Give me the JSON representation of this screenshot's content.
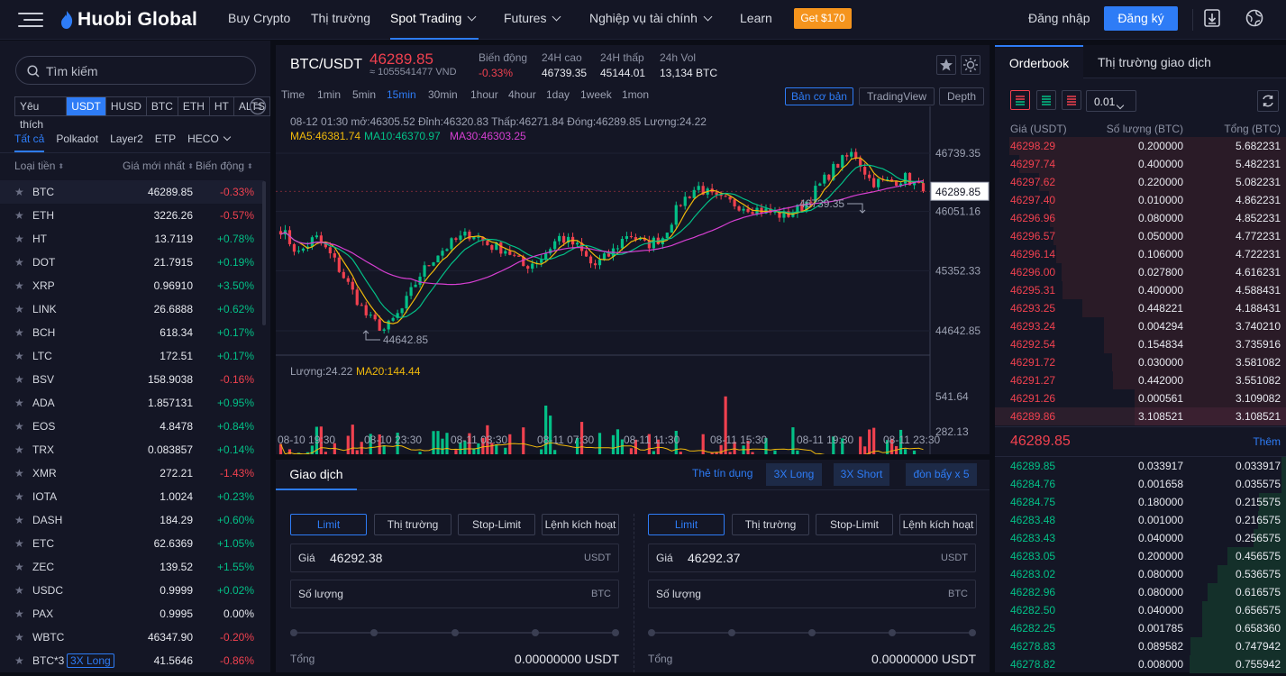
{
  "nav": {
    "logo_text": "Huobi Global",
    "items": [
      "Buy Crypto",
      "Thị trường",
      "Spot Trading",
      "Futures",
      "Nghiệp vụ tài chính",
      "Learn"
    ],
    "promo": "Get $170",
    "login": "Đăng nhập",
    "signup": "Đăng ký"
  },
  "market": {
    "search_placeholder": "Tìm kiếm",
    "quote_tabs": [
      "Yêu thích",
      "USDT",
      "HUSD",
      "BTC",
      "ETH",
      "HT",
      "ALTS"
    ],
    "sub_tabs": [
      "Tất cả",
      "Polkadot",
      "Layer2",
      "ETP",
      "HECO"
    ],
    "columns": {
      "coin": "Loại tiền",
      "price": "Giá mới nhất",
      "change": "Biến động"
    },
    "rows": [
      {
        "sym": "BTC",
        "price": "46289.85",
        "chg": "-0.33%",
        "dir": "down"
      },
      {
        "sym": "ETH",
        "price": "3226.26",
        "chg": "-0.57%",
        "dir": "down"
      },
      {
        "sym": "HT",
        "price": "13.7119",
        "chg": "+0.78%",
        "dir": "up"
      },
      {
        "sym": "DOT",
        "price": "21.7915",
        "chg": "+0.19%",
        "dir": "up"
      },
      {
        "sym": "XRP",
        "price": "0.96910",
        "chg": "+3.50%",
        "dir": "up"
      },
      {
        "sym": "LINK",
        "price": "26.6888",
        "chg": "+0.62%",
        "dir": "up"
      },
      {
        "sym": "BCH",
        "price": "618.34",
        "chg": "+0.17%",
        "dir": "up"
      },
      {
        "sym": "LTC",
        "price": "172.51",
        "chg": "+0.17%",
        "dir": "up"
      },
      {
        "sym": "BSV",
        "price": "158.9038",
        "chg": "-0.16%",
        "dir": "down"
      },
      {
        "sym": "ADA",
        "price": "1.857131",
        "chg": "+0.95%",
        "dir": "up"
      },
      {
        "sym": "EOS",
        "price": "4.8478",
        "chg": "+0.84%",
        "dir": "up"
      },
      {
        "sym": "TRX",
        "price": "0.083857",
        "chg": "+0.14%",
        "dir": "up"
      },
      {
        "sym": "XMR",
        "price": "272.21",
        "chg": "-1.43%",
        "dir": "down"
      },
      {
        "sym": "IOTA",
        "price": "1.0024",
        "chg": "+0.23%",
        "dir": "up"
      },
      {
        "sym": "DASH",
        "price": "184.29",
        "chg": "+0.60%",
        "dir": "up"
      },
      {
        "sym": "ETC",
        "price": "62.6369",
        "chg": "+1.05%",
        "dir": "up"
      },
      {
        "sym": "ZEC",
        "price": "139.52",
        "chg": "+1.55%",
        "dir": "up"
      },
      {
        "sym": "USDC",
        "price": "0.9999",
        "chg": "+0.02%",
        "dir": "up"
      },
      {
        "sym": "PAX",
        "price": "0.9995",
        "chg": "0.00%",
        "dir": "flat"
      },
      {
        "sym": "WBTC",
        "price": "46347.90",
        "chg": "-0.20%",
        "dir": "down"
      },
      {
        "sym": "BTC*3",
        "badge": "3X Long",
        "price": "41.5646",
        "chg": "-0.86%",
        "dir": "down"
      }
    ]
  },
  "ticker": {
    "pair": "BTC/USDT",
    "price": "46289.85",
    "fiat": "≈ 1055541477 VND",
    "stats": [
      {
        "label": "Biến động",
        "value": "-0.33%",
        "dir": "down"
      },
      {
        "label": "24H cao",
        "value": "46739.35",
        "dir": "flat"
      },
      {
        "label": "24H thấp",
        "value": "45144.01",
        "dir": "flat"
      },
      {
        "label": "24h Vol",
        "value": "13,134 BTC",
        "dir": "flat"
      }
    ]
  },
  "chart_toolbar": {
    "intervals": [
      "Time",
      "1min",
      "5min",
      "15min",
      "30min",
      "1hour",
      "4hour",
      "1day",
      "1week",
      "1mon"
    ],
    "active_interval": "15min",
    "views": [
      "Bản cơ bản",
      "TradingView",
      "Depth"
    ],
    "active_view": "Bản cơ bản"
  },
  "chart_data": {
    "type": "candlestick",
    "interval": "15min",
    "info_line": "08-12 01:30   mở:46305.52  Đỉnh:46320.83  Thấp:46271.84  Đóng:46289.85  Lượng:24.22",
    "ma_labels": [
      {
        "text": "MA5:46381.74",
        "color": "#f0b90b"
      },
      {
        "text": "MA10:46370.97",
        "color": "#03c087"
      },
      {
        "text": "MA30:46303.25",
        "color": "#d63fd2"
      }
    ],
    "y_ticks": [
      "46739.35",
      "46051.16",
      "45352.33",
      "44642.85"
    ],
    "y_tick_values": [
      46739.35,
      46051.16,
      45352.33,
      44642.85
    ],
    "ylim": [
      44400,
      47000
    ],
    "current_price": "46289.85",
    "high_marker": "46739.35",
    "low_marker": "44642.85",
    "volume_labels": [
      {
        "text": "Lượng:24.22",
        "color": "#9ca1b2"
      },
      {
        "text": "MA20:144.44",
        "color": "#f0b90b"
      }
    ],
    "volume_ticks": [
      "541.64",
      "282.13"
    ],
    "volume_tick_values": [
      541.64,
      282.13
    ],
    "x_labels": [
      "08-10 19:30",
      "08-10 23:30",
      "08-11 03:30",
      "08-11 07:30",
      "08-11 11:30",
      "08-11 15:30",
      "08-11 19:30",
      "08-11 23:30"
    ],
    "close_anchors": [
      45850,
      45550,
      45750,
      45500,
      45150,
      44800,
      44650,
      44900,
      45300,
      45550,
      45700,
      45800,
      45650,
      45600,
      45400,
      45500,
      45750,
      45650,
      45400,
      45550,
      45800,
      45650,
      45750,
      46150,
      46350,
      46200,
      46150,
      46100,
      46050,
      46000,
      46100,
      46350,
      46600,
      46750,
      46400,
      46400,
      46450,
      46289.85
    ]
  },
  "trade": {
    "tabs": [
      "Giao dịch"
    ],
    "links": [
      "Thẻ tín dụng",
      "3X Long",
      "3X Short",
      "đòn bẩy x 5"
    ],
    "order_types": [
      "Limit",
      "Thị trường",
      "Stop-Limit",
      "Lệnh kích hoạt"
    ],
    "buy": {
      "price_label": "Giá",
      "price": "46292.38",
      "price_unit": "USDT",
      "qty_label": "Số lượng",
      "qty_unit": "BTC",
      "total_label": "Tổng",
      "total": "0.00000000 USDT"
    },
    "sell": {
      "price_label": "Giá",
      "price": "46292.37",
      "price_unit": "USDT",
      "qty_label": "Số lượng",
      "qty_unit": "BTC",
      "total_label": "Tổng",
      "total": "0.00000000 USDT"
    }
  },
  "orderbook": {
    "tabs": [
      "Orderbook",
      "Thị trường giao dịch"
    ],
    "precision": "0.01",
    "headers": [
      "Giá (USDT)",
      "Số lượng (BTC)",
      "Tổng (BTC)"
    ],
    "last_price": "46289.85",
    "more": "Thêm",
    "asks": [
      {
        "p": "46298.29",
        "q": "0.200000",
        "t": "5.682231"
      },
      {
        "p": "46297.74",
        "q": "0.400000",
        "t": "5.482231"
      },
      {
        "p": "46297.62",
        "q": "0.220000",
        "t": "5.082231"
      },
      {
        "p": "46297.40",
        "q": "0.010000",
        "t": "4.862231"
      },
      {
        "p": "46296.96",
        "q": "0.080000",
        "t": "4.852231"
      },
      {
        "p": "46296.57",
        "q": "0.050000",
        "t": "4.772231"
      },
      {
        "p": "46296.14",
        "q": "0.106000",
        "t": "4.722231"
      },
      {
        "p": "46296.00",
        "q": "0.027800",
        "t": "4.616231"
      },
      {
        "p": "46295.31",
        "q": "0.400000",
        "t": "4.588431"
      },
      {
        "p": "46293.25",
        "q": "0.448221",
        "t": "4.188431"
      },
      {
        "p": "46293.24",
        "q": "0.004294",
        "t": "3.740210"
      },
      {
        "p": "46292.54",
        "q": "0.154834",
        "t": "3.735916"
      },
      {
        "p": "46291.72",
        "q": "0.030000",
        "t": "3.581082"
      },
      {
        "p": "46291.27",
        "q": "0.442000",
        "t": "3.551082"
      },
      {
        "p": "46291.26",
        "q": "0.000561",
        "t": "3.109082"
      },
      {
        "p": "46289.86",
        "q": "3.108521",
        "t": "3.108521"
      }
    ],
    "bids": [
      {
        "p": "46289.85",
        "q": "0.033917",
        "t": "0.033917"
      },
      {
        "p": "46284.76",
        "q": "0.001658",
        "t": "0.035575"
      },
      {
        "p": "46284.75",
        "q": "0.180000",
        "t": "0.215575"
      },
      {
        "p": "46283.48",
        "q": "0.001000",
        "t": "0.216575"
      },
      {
        "p": "46283.43",
        "q": "0.040000",
        "t": "0.256575"
      },
      {
        "p": "46283.05",
        "q": "0.200000",
        "t": "0.456575"
      },
      {
        "p": "46283.02",
        "q": "0.080000",
        "t": "0.536575"
      },
      {
        "p": "46282.96",
        "q": "0.080000",
        "t": "0.616575"
      },
      {
        "p": "46282.50",
        "q": "0.040000",
        "t": "0.656575"
      },
      {
        "p": "46282.25",
        "q": "0.001785",
        "t": "0.658360"
      },
      {
        "p": "46278.83",
        "q": "0.089582",
        "t": "0.747942"
      },
      {
        "p": "46278.82",
        "q": "0.008000",
        "t": "0.755942"
      }
    ]
  },
  "colors": {
    "up": "#03c087",
    "down": "#f0414f",
    "accent": "#2e7cf6",
    "promo": "#f5941d",
    "bg": "#141625"
  }
}
